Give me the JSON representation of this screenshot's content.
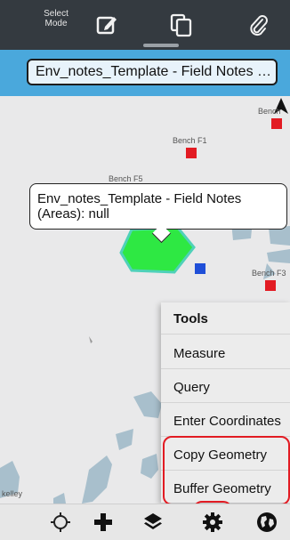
{
  "toolbar": {
    "select_mode_line1": "Select",
    "select_mode_line2": "Mode",
    "icons": [
      "edit-icon",
      "copy-icon",
      "attach-icon"
    ]
  },
  "layer_title": "Env_notes_Template - Field Notes (Ar...",
  "map": {
    "labels": [
      "Bench F1",
      "Bench F5",
      "Bench F3",
      "Bench",
      "kelley"
    ],
    "callout_text": "Env_notes_Template - Field Notes (Areas): null",
    "colors": {
      "marker": "#e21b23",
      "selected_marker": "#1f4fd8",
      "polygon": "#2ee843",
      "water": "#a8bfcc"
    }
  },
  "tools_menu": {
    "header": "Tools",
    "items": [
      "Measure",
      "Query",
      "Enter Coordinates",
      "Copy Geometry",
      "Buffer Geometry"
    ]
  },
  "bottom_bar": {
    "icons": [
      "location-icon",
      "add-icon",
      "layers-icon",
      "settings-icon",
      "basemap-globe-icon"
    ]
  },
  "highlight_color": "#e21b23"
}
